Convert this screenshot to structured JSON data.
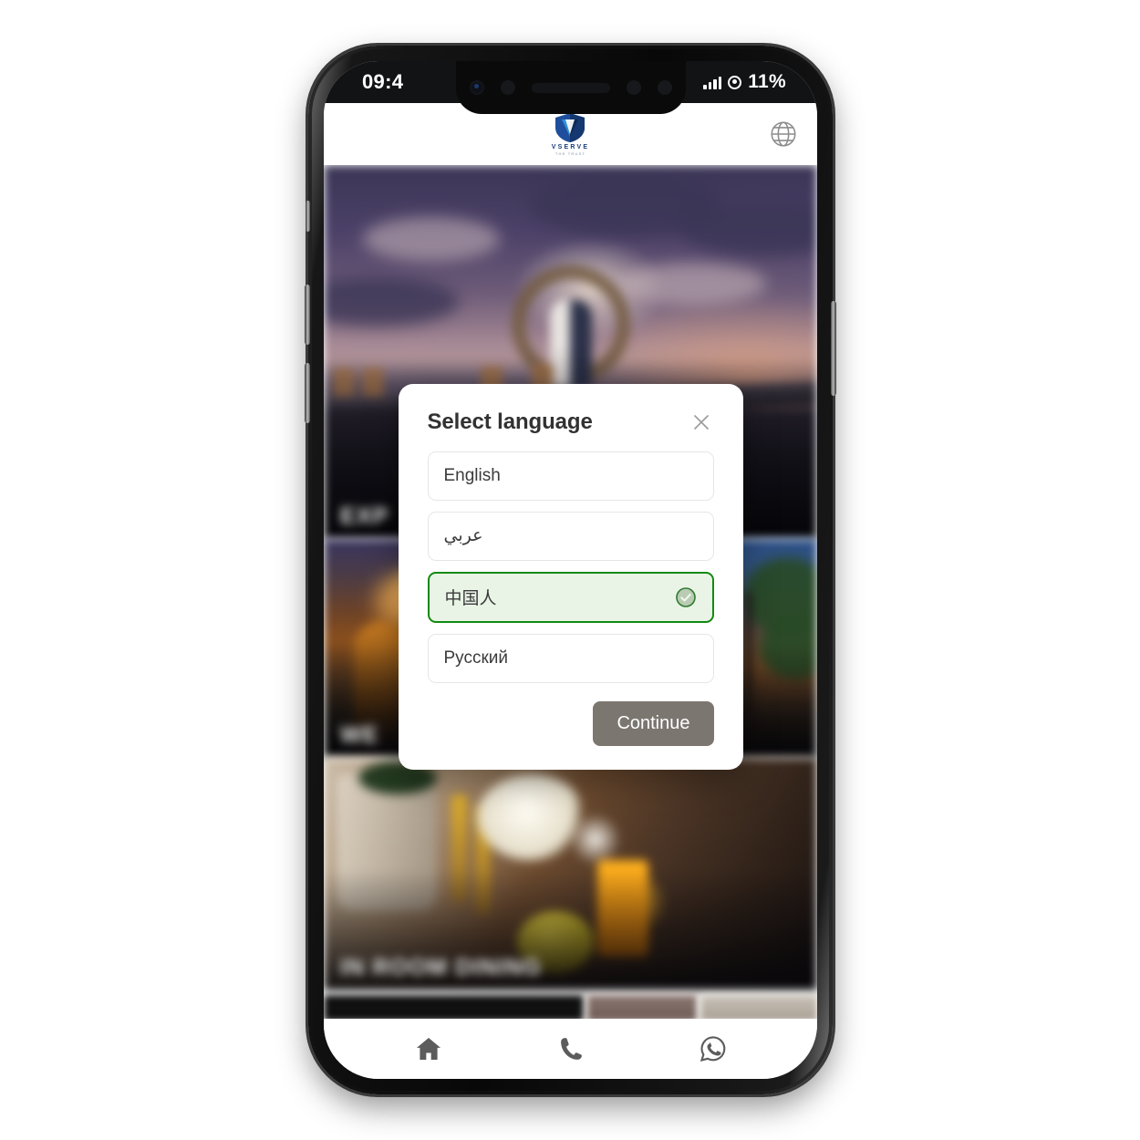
{
  "device": {
    "status_bar": {
      "time": "09:4",
      "battery": "11%",
      "signal_icon": "signal-bars-icon",
      "recording_icon": "record-indicator-icon"
    }
  },
  "app": {
    "header": {
      "logo_name": "VSERVE",
      "logo_tagline": "THE TRUST",
      "logo_icon": "vserve-shield-logo",
      "globe_icon": "globe-icon"
    },
    "cards": [
      {
        "label": "EXP",
        "name": "card-explore"
      },
      {
        "label": "WE",
        "name": "card-wedding"
      },
      {
        "label": "",
        "name": "card-right-thumb"
      },
      {
        "label": "IN ROOM DINING",
        "name": "card-in-room-dining"
      }
    ],
    "bottom_nav": [
      {
        "name": "nav-home",
        "icon": "home-icon",
        "label": "Home"
      },
      {
        "name": "nav-call",
        "icon": "phone-icon",
        "label": "Call"
      },
      {
        "name": "nav-whatsapp",
        "icon": "whatsapp-icon",
        "label": "WhatsApp"
      }
    ]
  },
  "dialog": {
    "title": "Select language",
    "close_icon": "close-icon",
    "check_icon": "check-circle-icon",
    "options": [
      {
        "label": "English",
        "selected": false
      },
      {
        "label": "عربي",
        "selected": false
      },
      {
        "label": "中国人",
        "selected": true
      },
      {
        "label": "Русский",
        "selected": false
      }
    ],
    "continue_label": "Continue"
  },
  "colors": {
    "selected_border": "#118a11",
    "selected_bg": "#e9f4e6",
    "continue_bg": "#7b7670",
    "logo_blue": "#1b3f77"
  }
}
